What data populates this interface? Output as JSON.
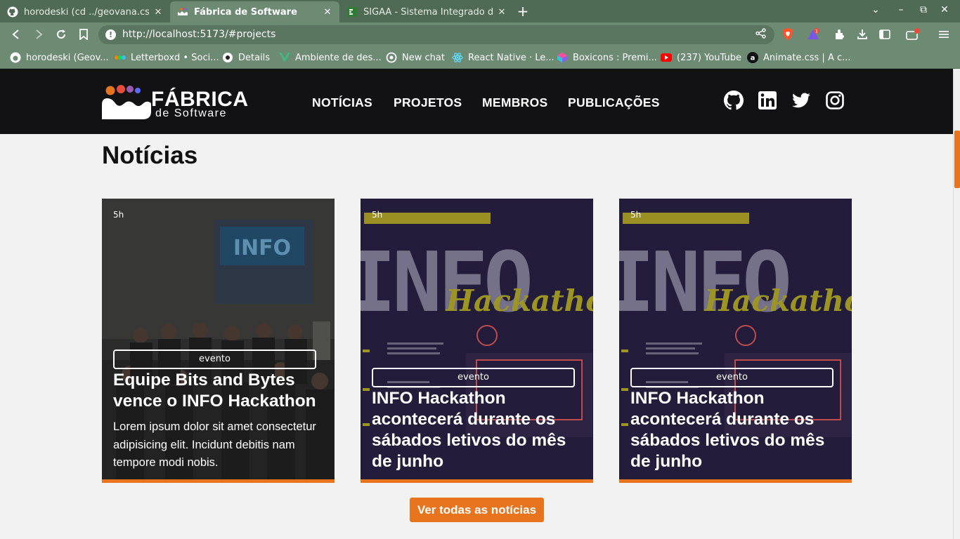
{
  "browser": {
    "tabs": [
      {
        "title": "horodeski (cd ../geovana.css)",
        "icon": "github-icon",
        "active": false
      },
      {
        "title": "Fábrica de Software",
        "icon": "fabrica-favicon",
        "active": true
      },
      {
        "title": "SIGAA - Sistema Integrado de Gest",
        "icon": "sigaa-favicon",
        "active": false
      }
    ],
    "new_tab_label": "+",
    "address": {
      "url": "http://localhost:5173/#projects"
    },
    "extension_badge": "1",
    "bookmarks": [
      {
        "label": "horodeski (Geov...",
        "icon": "github-icon"
      },
      {
        "label": "Letterboxd • Soci...",
        "icon": "letterboxd-icon"
      },
      {
        "label": "Details",
        "icon": "details-icon"
      },
      {
        "label": "Ambiente de des...",
        "icon": "vue-icon"
      },
      {
        "label": "New chat",
        "icon": "openai-icon"
      },
      {
        "label": "React Native · Le...",
        "icon": "react-icon"
      },
      {
        "label": "Boxicons : Premi...",
        "icon": "boxicons-icon"
      },
      {
        "label": "(237) YouTube",
        "icon": "youtube-icon"
      },
      {
        "label": "Animate.css | A c...",
        "icon": "animate-icon"
      }
    ]
  },
  "site": {
    "logo": {
      "line1": "FÁBRICA",
      "line2": "de Software"
    },
    "nav": [
      "NOTÍCIAS",
      "PROJETOS",
      "MEMBROS",
      "PUBLICAÇÕES"
    ],
    "social": [
      "github-icon",
      "linkedin-icon",
      "twitter-icon",
      "instagram-icon"
    ],
    "section_title": "Notícias",
    "cards": [
      {
        "age": "5h",
        "tag": "evento",
        "title": "Equipe Bits and Bytes vence o INFO Hackathon",
        "description": "Lorem ipsum dolor sit amet consectetur adipisicing elit. Incidunt debitis nam tempore modi nobis."
      },
      {
        "age": "5h",
        "tag": "evento",
        "title": "INFO Hackathon acontecerá durante os sábados letivos do mês de junho",
        "description": ""
      },
      {
        "age": "5h",
        "tag": "evento",
        "title": "INFO Hackathon acontecerá durante os sábados letivos do mês de junho",
        "description": ""
      }
    ],
    "cta_label": "Ver todas as notícias",
    "colors": {
      "accent": "#e8741e",
      "header_bg": "#121214",
      "page_bg": "#f2f2f2"
    }
  }
}
